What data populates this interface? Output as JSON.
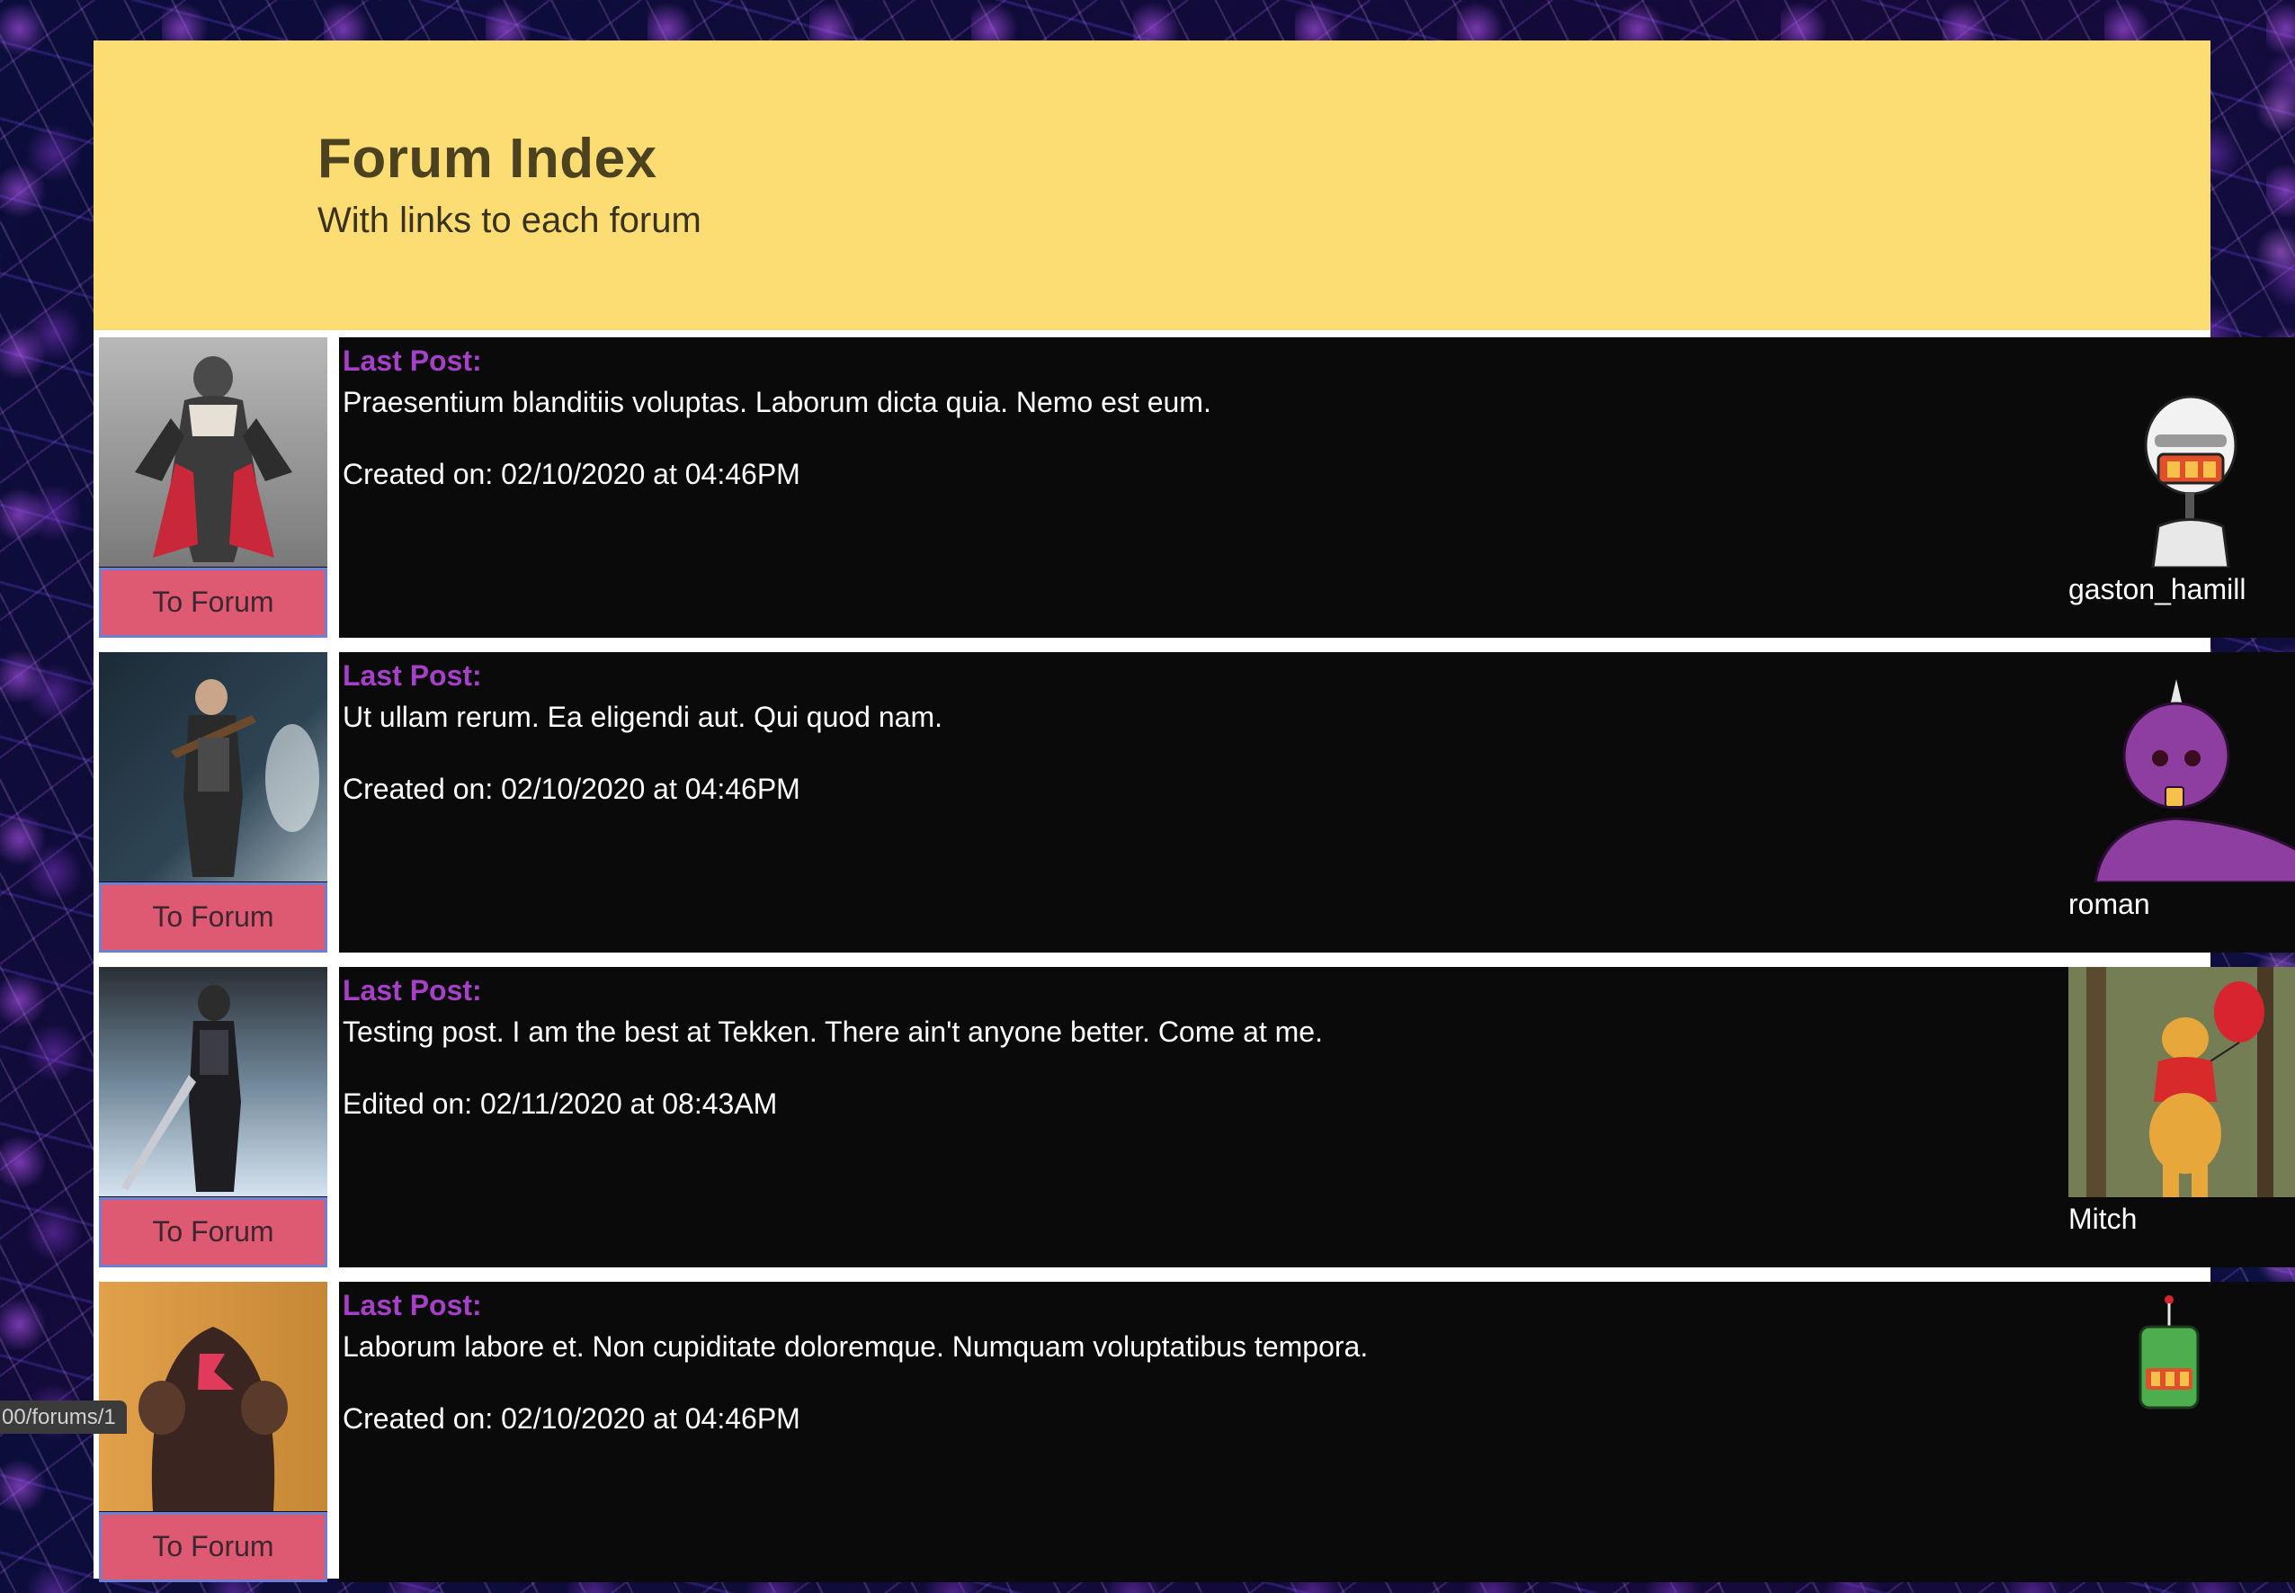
{
  "header": {
    "title": "Forum Index",
    "subtitle": "With links to each forum"
  },
  "forums": [
    {
      "button_label": "To Forum",
      "last_post_label": "Last Post:",
      "post_text": "Praesentium blanditiis voluptas. Laborum dicta quia. Nemo est eum.",
      "date_text": "Created on: 02/10/2020 at 04:46PM",
      "username": "gaston_hamill",
      "avatar_icon": "white-robot-avatar",
      "thumb_icon": "tekken-fighter-thumbnail"
    },
    {
      "button_label": "To Forum",
      "last_post_label": "Last Post:",
      "post_text": "Ut ullam rerum. Ea eligendi aut. Qui quod nam.",
      "date_text": "Created on: 02/10/2020 at 04:46PM",
      "username": "roman",
      "avatar_icon": "purple-robot-avatar",
      "thumb_icon": "tekken-fighter-thumbnail"
    },
    {
      "button_label": "To Forum",
      "last_post_label": "Last Post:",
      "post_text": "Testing post. I am the best at Tekken. There ain't anyone better. Come at me.",
      "date_text": "Edited on: 02/11/2020 at 08:43AM",
      "username": "Mitch",
      "avatar_icon": "bear-with-balloon-avatar",
      "thumb_icon": "tekken-fighter-thumbnail"
    },
    {
      "button_label": "To Forum",
      "last_post_label": "Last Post:",
      "post_text": "Laborum labore et. Non cupiditate doloremque. Numquam voluptatibus tempora.",
      "date_text": "Created on: 02/10/2020 at 04:46PM",
      "username": "",
      "avatar_icon": "green-robot-avatar",
      "thumb_icon": "tekken-fighter-thumbnail"
    }
  ],
  "status_bar": {
    "url": "00/forums/1"
  },
  "colors": {
    "header_bg": "#fbdd74",
    "button_bg": "#de5a72",
    "last_post_label": "#a640c8",
    "post_bg": "#0a0a0a"
  }
}
